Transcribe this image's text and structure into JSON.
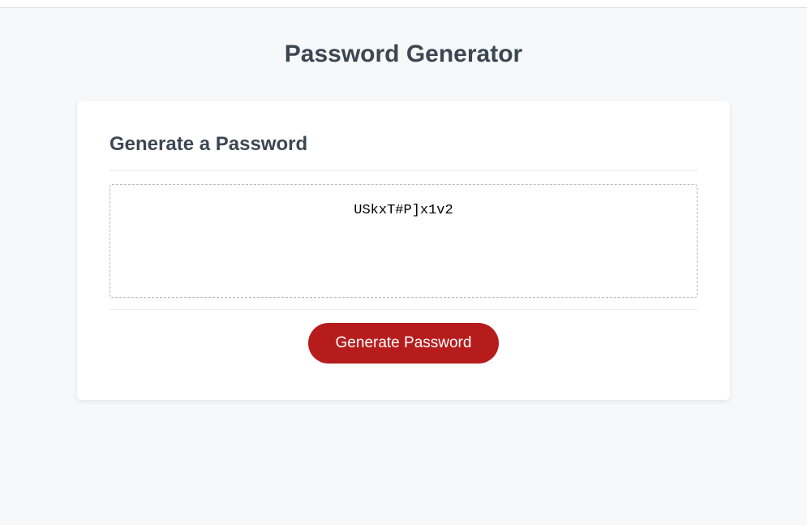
{
  "page": {
    "title": "Password Generator"
  },
  "card": {
    "heading": "Generate a Password",
    "password_value": "USkxT#P]x1v2",
    "button_label": "Generate Password"
  }
}
